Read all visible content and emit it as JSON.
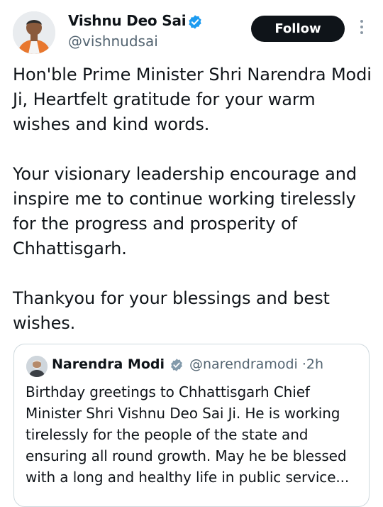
{
  "author": {
    "name": "Vishnu Deo Sai",
    "handle": "@vishnudsai",
    "verified_icon": "verified-badge-icon",
    "badge_color": "#1d9bf0"
  },
  "follow_label": "Follow",
  "more_icon": "more-vertical-icon",
  "tweet_text": "Hon'ble Prime Minister Shri Narendra Modi Ji, Heartfelt gratitude for your warm wishes and kind words.\n\nYour visionary leadership encourage and inspire me to continue working tirelessly for the progress and prosperity of Chhattisgarh.\n\nThankyou for your blessings and best wishes.",
  "quote": {
    "name": "Narendra Modi",
    "handle": "@narendramodi",
    "separator": "·",
    "time": "2h",
    "badge_color": "#829aab",
    "text": "Birthday greetings to Chhattisgarh Chief Minister Shri Vishnu Deo Sai Ji. He is working tirelessly for the people of the state and ensuring all round growth. May he be blessed with a long and healthy life in public service..."
  }
}
